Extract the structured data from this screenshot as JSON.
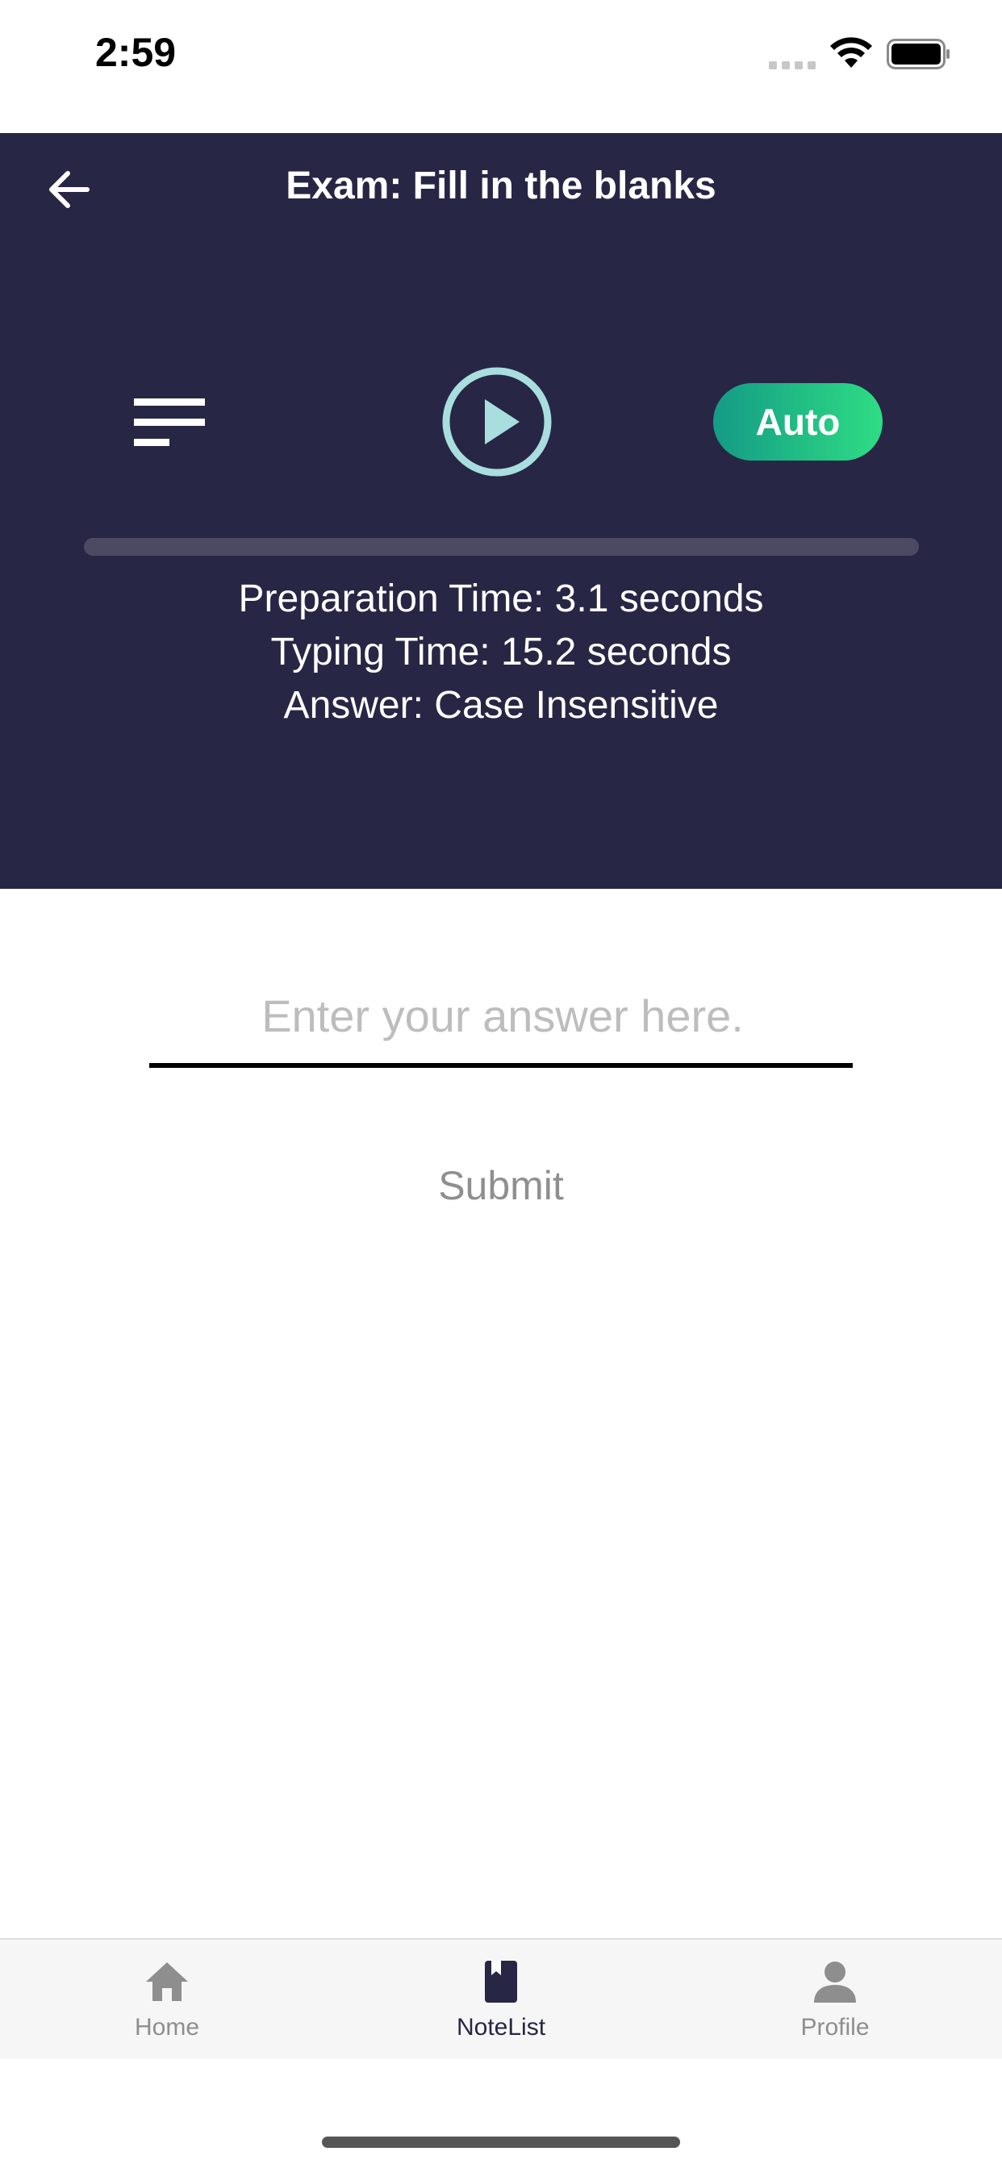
{
  "status_bar": {
    "time": "2:59"
  },
  "header": {
    "title": "Exam: Fill in the blanks",
    "auto_label": "Auto",
    "progress": 0,
    "info": {
      "preparation": "Preparation Time: 3.1 seconds",
      "typing": "Typing Time: 15.2 seconds",
      "answer": "Answer: Case Insensitive"
    }
  },
  "answer": {
    "value": "",
    "placeholder": "Enter your answer here.",
    "submit_label": "Submit"
  },
  "tab_bar": {
    "items": [
      {
        "label": "Home",
        "icon": "home-icon",
        "active": false
      },
      {
        "label": "NoteList",
        "icon": "bookmark-book-icon",
        "active": true
      },
      {
        "label": "Profile",
        "icon": "person-icon",
        "active": false
      }
    ]
  },
  "colors": {
    "header_bg": "#282645",
    "accent_play": "#a8dede",
    "auto_gradient_start": "#149b86",
    "auto_gradient_end": "#2edd83",
    "tab_active": "#282645",
    "tab_inactive": "#8e8e8e"
  }
}
